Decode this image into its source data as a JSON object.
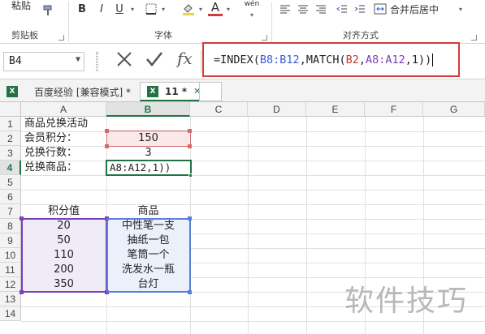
{
  "ribbon": {
    "clipboard": {
      "paste_label": "粘贴",
      "group_label": "剪贴板"
    },
    "font": {
      "group_label": "字体",
      "bold": "B",
      "italic": "I",
      "underline": "U",
      "font_color": "A",
      "wen": "wén"
    },
    "alignment": {
      "group_label": "对齐方式",
      "merge_label": "合并后居中"
    }
  },
  "formula_bar": {
    "name_box": "B4",
    "fx": "fx",
    "formula": {
      "p1": "=INDEX(",
      "p2": "B8:B12",
      "p3": ",MATCH(",
      "p4": "B2",
      "p5": ",",
      "p6": "A8:A12",
      "p7": ",1))"
    }
  },
  "tabs": [
    {
      "label": "百度经验  [兼容模式] *"
    },
    {
      "label": "11 *"
    }
  ],
  "columns": [
    "A",
    "B",
    "C",
    "D",
    "E",
    "F",
    "G"
  ],
  "rows": [
    "1",
    "2",
    "3",
    "4",
    "5",
    "6",
    "7",
    "8",
    "9",
    "10",
    "11",
    "12",
    "13",
    "14"
  ],
  "cells": {
    "A1": "商品兑换活动",
    "A2": "会员积分：",
    "B2": "150",
    "A3": "兑换行数：",
    "B3": "3",
    "A4": "兑换商品：",
    "B4": "A8:A12,1))",
    "A7": "积分值",
    "B7": "商品",
    "A8": "20",
    "B8": "中性笔一支",
    "A9": "50",
    "B9": "抽纸一包",
    "A10": "110",
    "B10": "笔筒一个",
    "A11": "200",
    "B11": "洗发水一瓶",
    "A12": "350",
    "B12": "台灯"
  },
  "watermark": "软件技巧",
  "colors": {
    "accent": "#217346",
    "highlight_red": "#d43a3a",
    "range_blue": "#3b5bd1",
    "range_purple": "#7b3fb8"
  }
}
